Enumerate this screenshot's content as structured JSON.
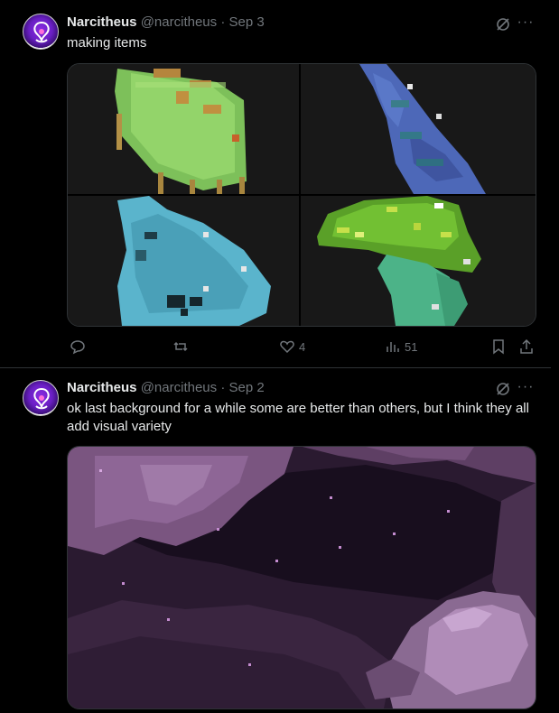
{
  "tweets": [
    {
      "author_name": "Narcitheus",
      "handle": "@narcitheus",
      "separator": "·",
      "date": "Sep 3",
      "text": "making items",
      "actions": {
        "replies": "",
        "reposts": "",
        "likes": "4",
        "views": "51"
      },
      "media_description_icons": [
        "leaf-item",
        "horn-item",
        "crystal-item",
        "mushroom-item"
      ]
    },
    {
      "author_name": "Narcitheus",
      "handle": "@narcitheus",
      "separator": "·",
      "date": "Sep 2",
      "text": "ok last background for a while some are better than others, but I think they all add visual variety"
    }
  ],
  "colors": {
    "background": "#000000",
    "text": "#e7e9ea",
    "muted": "#71767b",
    "divider": "#2f3336",
    "avatar_purple": "#7b2ee0"
  },
  "icons": [
    "grok-icon",
    "more-icon",
    "reply-icon",
    "repost-icon",
    "like-icon",
    "views-icon",
    "bookmark-icon",
    "share-icon"
  ]
}
